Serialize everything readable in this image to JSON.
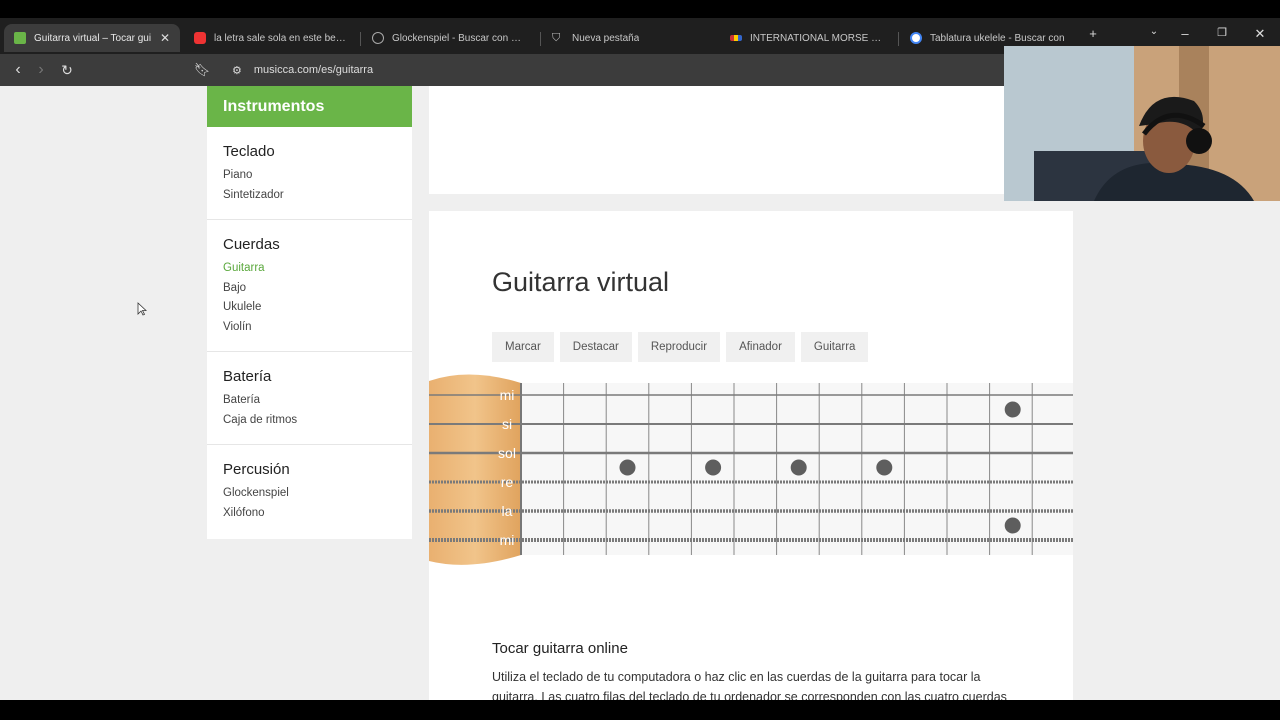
{
  "tabs": [
    {
      "title": "Guitarra virtual – Tocar gui",
      "active": true,
      "color": "#6ab548"
    },
    {
      "title": "la letra sale sola en este beat (m",
      "color": "#e33"
    },
    {
      "title": "Glockenspiel - Buscar con Goo",
      "color": "#aaa"
    },
    {
      "title": "Nueva pestaña",
      "color": "#aaa"
    },
    {
      "title": "INTERNATIONAL MORSE CODE",
      "color": "#c33"
    },
    {
      "title": "Tablatura ukelele - Buscar con",
      "color": "#4285f4"
    }
  ],
  "url": "musicca.com/es/guitarra",
  "sidebar": {
    "header": "Instrumentos",
    "groups": [
      {
        "title": "Teclado",
        "items": [
          "Piano",
          "Sintetizador"
        ]
      },
      {
        "title": "Cuerdas",
        "items": [
          "Guitarra",
          "Bajo",
          "Ukulele",
          "Violín"
        ]
      },
      {
        "title": "Batería",
        "items": [
          "Batería",
          "Caja de ritmos"
        ]
      },
      {
        "title": "Percusión",
        "items": [
          "Glockenspiel",
          "Xilófono"
        ]
      }
    ],
    "selected": "Guitarra",
    "accent": "#6ab548"
  },
  "main": {
    "title": "Guitarra virtual",
    "buttons": [
      "Marcar",
      "Destacar",
      "Reproducir",
      "Afinador",
      "Guitarra"
    ],
    "strings": [
      "mi",
      "si",
      "sol",
      "re",
      "la",
      "mi"
    ],
    "dots": [
      {
        "string": 1,
        "fret": 12
      },
      {
        "string": 3,
        "fret": 3
      },
      {
        "string": 3,
        "fret": 5
      },
      {
        "string": 3,
        "fret": 7
      },
      {
        "string": 3,
        "fret": 9
      },
      {
        "string": 5,
        "fret": 12
      }
    ],
    "subtitle": "Tocar guitarra online",
    "paragraph": "Utiliza el teclado de tu computadora o haz clic en las cuerdas de la guitarra para tocar la guitarra. Las cuatro filas del teclado de tu ordenador se corresponden con las cuatro cuerdas más bajas de la guitarra. Mantén presionada la tecla Shift (⇧) y utiliza"
  }
}
